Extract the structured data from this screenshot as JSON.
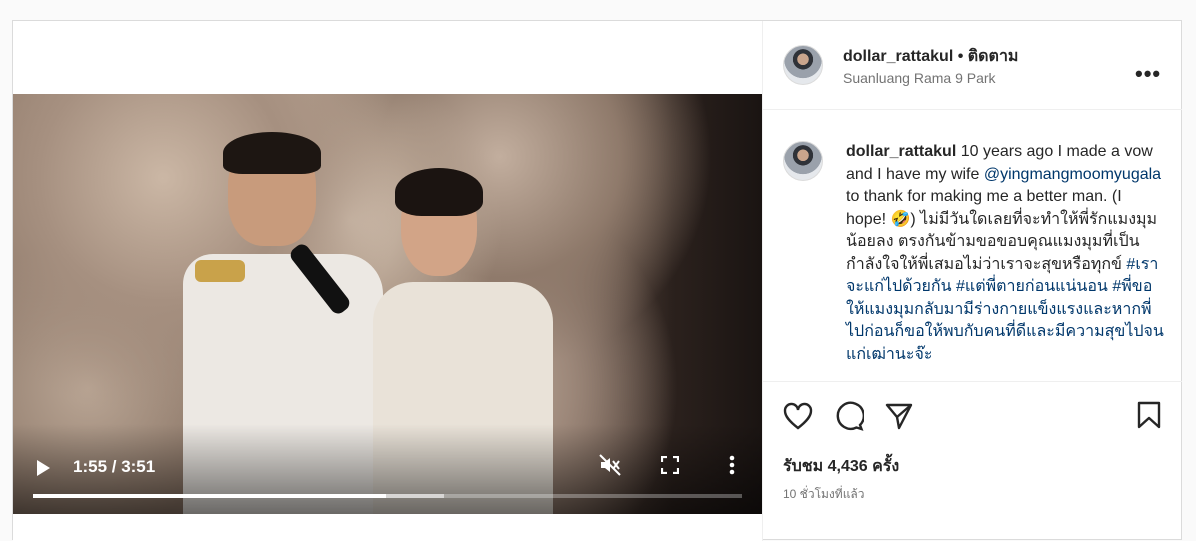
{
  "post": {
    "username": "dollar_rattakul",
    "follow_label": "• ติดตาม",
    "location": "Suanluang Rama 9 Park",
    "more_label": "•••"
  },
  "video": {
    "time_display": "1:55 / 3:51",
    "progress": 0.4978,
    "buffered": 0.58,
    "muted": true
  },
  "caption": {
    "username": "dollar_rattakul",
    "text_1": " 10 years ago I made a vow and I have my wife ",
    "mention": "@yingmangmoomyugala",
    "text_2": " to thank for making me a better man. (I hope! 🤣) ไม่มีวันใดเลยที่จะทำให้พี่รักแมงมุมน้อยลง ตรงกันข้ามขอขอบคุณแมงมุมที่เป็นกำลังใจให้พี่เสมอไม่ว่าเราจะสุขหรือทุกข์ ",
    "hashtag_1": "#เราจะแก่ไปด้วยกัน",
    "hashtag_2": "#แต่พี่ตายก่อนแน่นอน",
    "hashtag_3": "#พี่ขอให้แมงมุมกลับมามีร่างกายแข็งแรงและหากพี่ไปก่อนก็ขอให้พบกับคนที่ดีและมีความสุขไปจนแก่เฒ่านะจ๊ะ"
  },
  "engagement": {
    "likes": "รับชม 4,436 ครั้ง",
    "time_ago": "10 ชั่วโมงที่แล้ว"
  },
  "colors": {
    "link": "#00376b",
    "text": "#262626",
    "muted": "#737373",
    "border": "#dbdbdb"
  }
}
